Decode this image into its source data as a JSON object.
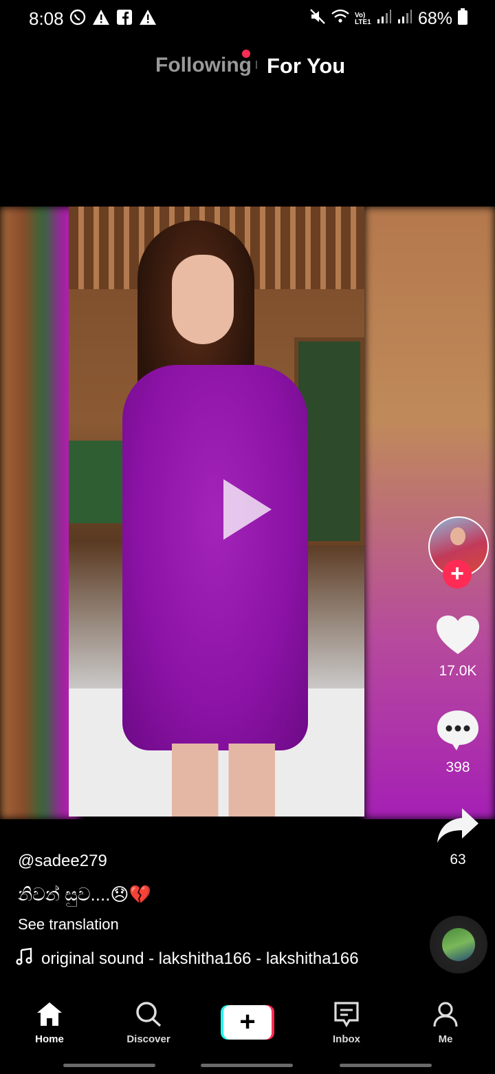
{
  "status_bar": {
    "time": "8:08",
    "battery": "68%",
    "network": "Vo) LTE1"
  },
  "tabs": {
    "following": "Following",
    "for_you": "For You"
  },
  "video": {
    "playing": false
  },
  "actions": {
    "likes": "17.0K",
    "comments": "398",
    "shares": "63"
  },
  "post": {
    "username": "@sadee279",
    "caption": "නිවන් සුව....😞💔",
    "see_translation": "See translation",
    "sound": "original sound - lakshitha166 - lakshitha166"
  },
  "nav": {
    "home": "Home",
    "discover": "Discover",
    "inbox": "Inbox",
    "me": "Me"
  },
  "colors": {
    "accent": "#fe2c55",
    "cyan": "#25f4ee",
    "background": "#000000"
  }
}
